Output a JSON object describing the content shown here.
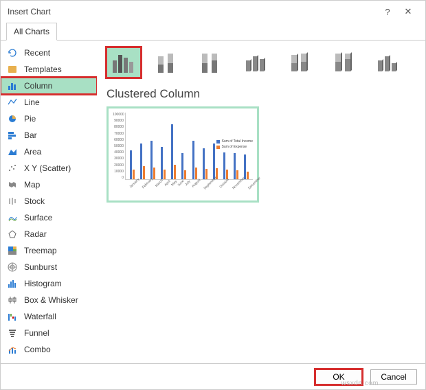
{
  "dialog": {
    "title": "Insert Chart",
    "help": "?",
    "close": "✕",
    "tab": "All Charts"
  },
  "sidebar": [
    {
      "key": "recent",
      "label": "Recent"
    },
    {
      "key": "templates",
      "label": "Templates"
    },
    {
      "key": "column",
      "label": "Column",
      "selected": true,
      "highlight": true
    },
    {
      "key": "line",
      "label": "Line"
    },
    {
      "key": "pie",
      "label": "Pie"
    },
    {
      "key": "bar",
      "label": "Bar"
    },
    {
      "key": "area",
      "label": "Area"
    },
    {
      "key": "xy",
      "label": "X Y (Scatter)"
    },
    {
      "key": "map",
      "label": "Map"
    },
    {
      "key": "stock",
      "label": "Stock"
    },
    {
      "key": "surface",
      "label": "Surface"
    },
    {
      "key": "radar",
      "label": "Radar"
    },
    {
      "key": "treemap",
      "label": "Treemap"
    },
    {
      "key": "sunburst",
      "label": "Sunburst"
    },
    {
      "key": "histogram",
      "label": "Histogram"
    },
    {
      "key": "boxwhisker",
      "label": "Box & Whisker"
    },
    {
      "key": "waterfall",
      "label": "Waterfall"
    },
    {
      "key": "funnel",
      "label": "Funnel"
    },
    {
      "key": "combo",
      "label": "Combo"
    }
  ],
  "subtypes": [
    {
      "name": "clustered-column",
      "selected": true,
      "highlight": true
    },
    {
      "name": "stacked-column"
    },
    {
      "name": "100-stacked-column"
    },
    {
      "name": "3d-clustered-column"
    },
    {
      "name": "3d-stacked-column"
    },
    {
      "name": "3d-100-stacked-column"
    },
    {
      "name": "3d-column"
    }
  ],
  "preview": {
    "title": "Clustered Column"
  },
  "chart_data": {
    "type": "bar",
    "categories": [
      "January",
      "February",
      "March",
      "April",
      "May",
      "June",
      "July",
      "August",
      "September",
      "October",
      "November",
      "December"
    ],
    "series": [
      {
        "name": "Sum of Total Income",
        "color": "#4472c4",
        "values": [
          45000,
          55000,
          60000,
          50000,
          85000,
          40000,
          60000,
          48000,
          55000,
          42000,
          40000,
          38000
        ]
      },
      {
        "name": "Sum of Expense",
        "color": "#ed7d31",
        "values": [
          15000,
          20000,
          18000,
          15000,
          22000,
          14000,
          18000,
          16000,
          17000,
          15000,
          14000,
          12000
        ]
      }
    ],
    "ylim": [
      0,
      100000
    ],
    "yticks": [
      0,
      10000,
      20000,
      30000,
      40000,
      50000,
      60000,
      70000,
      80000,
      90000,
      100000
    ]
  },
  "buttons": {
    "ok": "OK",
    "cancel": "Cancel"
  },
  "watermark": "wsxdn.com"
}
